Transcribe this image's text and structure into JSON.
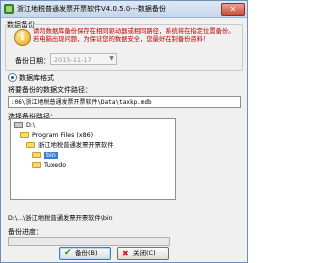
{
  "window": {
    "title": "浙江地税普通发票开票软件V4.0.5.0---数据备份",
    "close_glyph": "✕"
  },
  "group": {
    "title": "数据备份",
    "warning": "请勿数据库备份保存在相同驱动器或相同路径，系统将在指定位置备份。若电脑出现问题，为保证您的数据安全，您最好在制备份资料！",
    "date_label": "备份日期：",
    "date_value": "2015-11-17",
    "date_dropdown_glyph": "▼"
  },
  "format": {
    "radio_label": "数据库格式"
  },
  "path": {
    "label": "将要备份的数据文件路径：",
    "value": ":06\\浙江地税普通发票开票软件\\Data\\taxkp.mdb"
  },
  "tree": {
    "label": "选择备份路径：",
    "items": [
      {
        "label": "D:\\"
      },
      {
        "label": "Program Files (x86)"
      },
      {
        "label": "浙江地税普通发票开票软件"
      },
      {
        "label": "bin",
        "selected": true
      },
      {
        "label": "Tuxedo"
      }
    ]
  },
  "current_path": "D:\\...\\浙江地税普通发票开票软件\\bin",
  "progress": {
    "label": "备份进度：",
    "value": 0
  },
  "buttons": {
    "backup": "备份(B)",
    "close": "关闭(C)"
  },
  "icons": {
    "check": "✔",
    "x": "✖"
  },
  "colors": {
    "warning": "#c00000",
    "selection": "#3d7bd6",
    "progress": "#5ab552"
  }
}
